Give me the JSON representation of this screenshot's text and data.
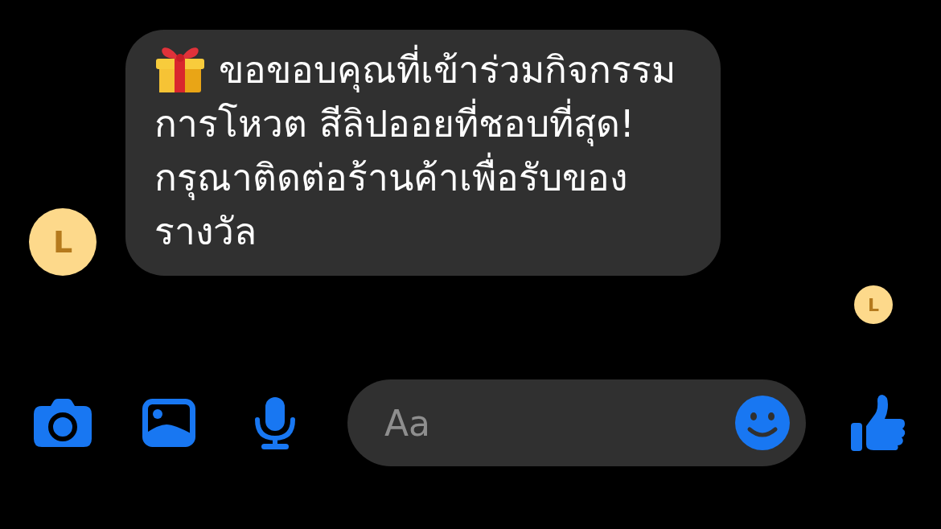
{
  "thread": {
    "messages": [
      {
        "sender_initial": "L",
        "lines": [
          "ขอขอบคุณที่เข้าร่วมกิจกรรม",
          "การโหวต สีลิปออยที่ชอบที่สุด!",
          "กรุณาติดต่อร้านค้าเพื่อรับของ",
          "รางวัล"
        ]
      }
    ],
    "seen_by": [
      {
        "initial": "L"
      }
    ]
  },
  "composer": {
    "placeholder": "Aa"
  }
}
